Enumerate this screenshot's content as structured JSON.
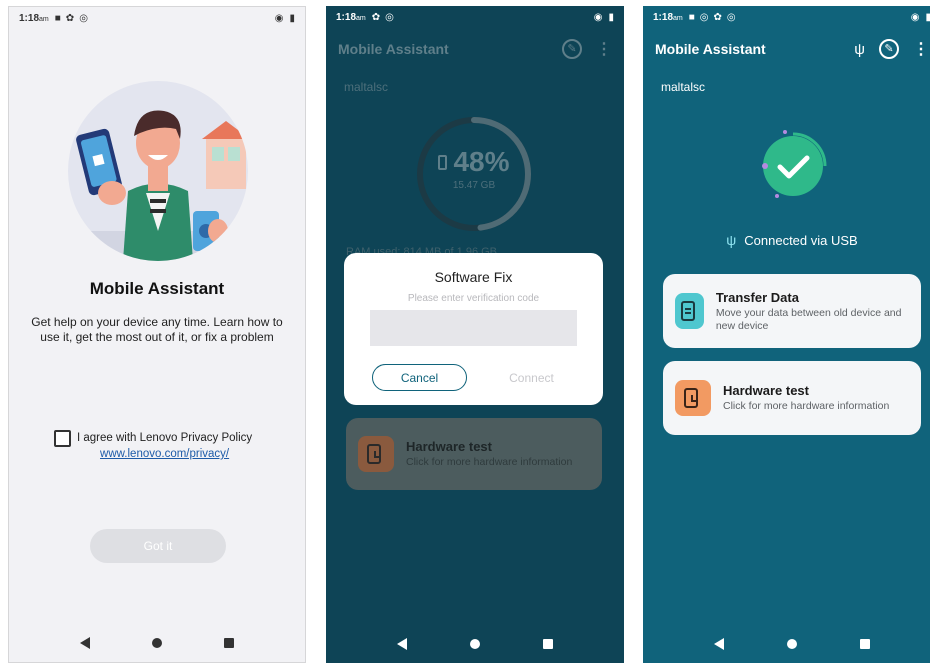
{
  "screen1": {
    "status": {
      "time": "1:18",
      "ampm": "am"
    },
    "title": "Mobile Assistant",
    "description": "Get help on your device any time. Learn how to use it, get the most out of it, or fix a problem",
    "agree_text": "I agree with Lenovo Privacy Policy",
    "privacy_link": "www.lenovo.com/privacy/",
    "button_label": "Got it",
    "colors": {
      "background": "#f2f2f5",
      "button_disabled": "#dedfe3",
      "link": "#1d5ba8"
    }
  },
  "screen2": {
    "status": {
      "time": "1:18",
      "ampm": "am"
    },
    "app_title": "Mobile Assistant",
    "device_name": "maltalsc",
    "storage_percent": "48%",
    "storage_size": "15.47 GB",
    "ram_text": "RAM used: 814 MB of 1.96 GB",
    "storage_fraction": 0.48,
    "dialog": {
      "title": "Software Fix",
      "placeholder": "Please enter verification code",
      "cancel_label": "Cancel",
      "connect_label": "Connect"
    },
    "card": {
      "title": "Hardware test",
      "subtitle": "Click for more hardware information"
    },
    "colors": {
      "background": "#0e4456",
      "accent": "#10637b"
    }
  },
  "screen3": {
    "status": {
      "time": "1:18",
      "ampm": "am"
    },
    "app_title": "Mobile Assistant",
    "device_name": "maltalsc",
    "usb_status": "Connected via USB",
    "cards": [
      {
        "title": "Transfer Data",
        "subtitle": "Move your data between old device and new device",
        "icon": "transfer-data-icon"
      },
      {
        "title": "Hardware test",
        "subtitle": "Click for more hardware information",
        "icon": "hardware-test-icon"
      }
    ],
    "colors": {
      "background": "#10637b",
      "success": "#2fb98a",
      "transfer_icon_bg": "#4fc7cf",
      "hardware_icon_bg": "#f29a62"
    }
  }
}
